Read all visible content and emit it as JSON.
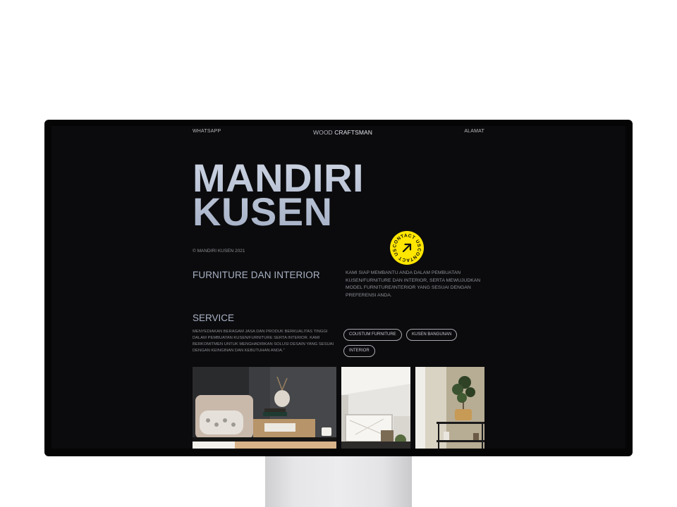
{
  "nav": {
    "left_link": "WHATSAPP",
    "brand_light": "WOOD ",
    "brand_bold": "CRAFTSMAN",
    "right_link": "ALAMAT"
  },
  "hero": {
    "line1": "MANDIRI",
    "line2": "KUSEN"
  },
  "copyright": "© MANDIRI KUSEN 2021",
  "contact_badge": {
    "text": "CONTACT US",
    "icon": "arrow-up-right-icon",
    "color": "#ffe600"
  },
  "subtitle": "FURNITURE DAN INTERIOR",
  "intro": "KAMI SIAP MEMBANTU ANDA DALAM PEMBUATAN KUSEN/FURNITURE DAN INTERIOR, SERTA MEWUJUDKAN MODEL FURNITURE/INTERIOR YANG SESUAI DENGAN PREFERENSI ANDA.",
  "service": {
    "title": "SERVICE",
    "description": "MENYEDIAKAN BERAGAM JASA DAN PRODUK BERKUALITAS TINGGI DALAM PEMBUATAN KUSEN/FURNITURE SERTA INTERIOR. KAMI BERKOMITMEN UNTUK MENGHADIRKAN SOLUSI DESAIN YANG SESUAI DENGAN KEINGINAN DAN KEBUTUHAN ANDA.\"",
    "tags": [
      "COUSTUM FURNITURE",
      "KUSEN BANGUNAN",
      "INTERIOR"
    ]
  },
  "colors": {
    "background": "#0b0b0d",
    "accent": "#ffe600",
    "hero_text": "#b9c2d4"
  }
}
